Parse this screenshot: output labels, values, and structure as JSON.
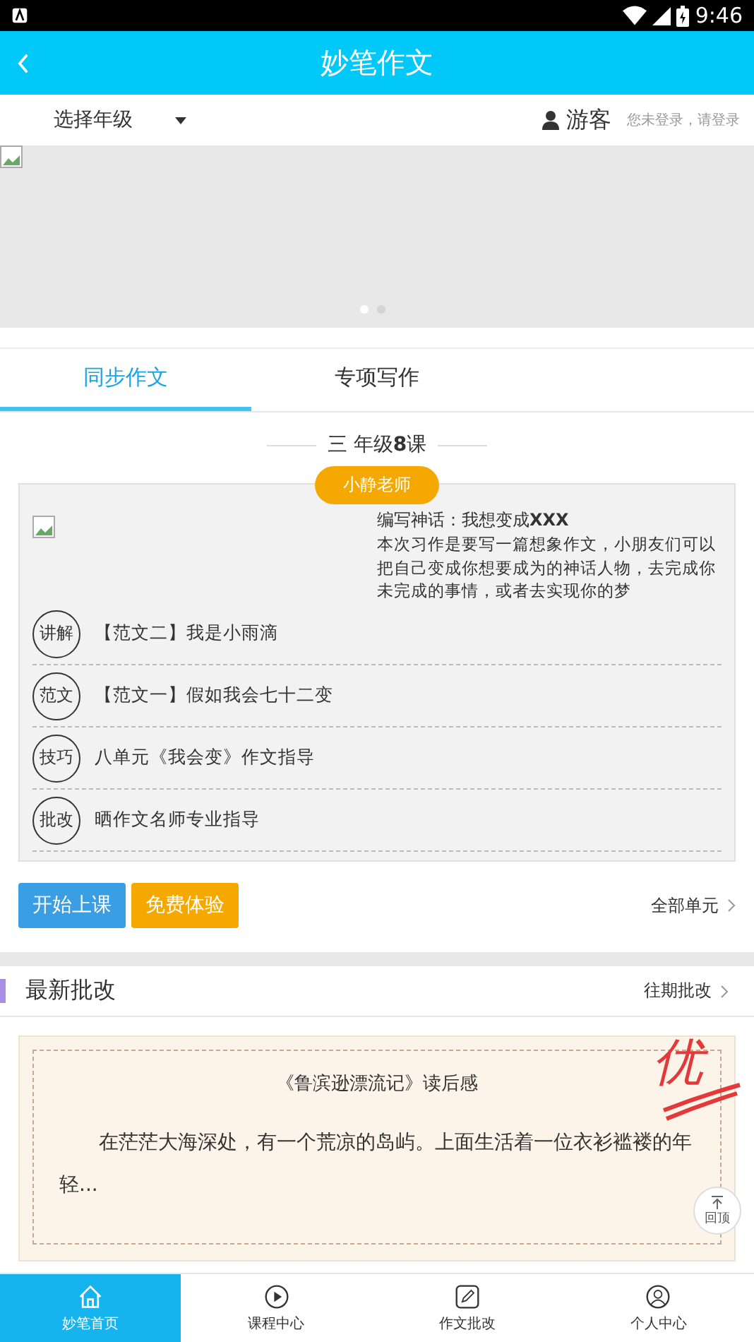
{
  "status_bar": {
    "time": "9:46"
  },
  "header": {
    "title": "妙笔作文"
  },
  "grade_bar": {
    "grade_select": "选择年级",
    "user_name": "游客",
    "login_hint": "您未登录，请登录"
  },
  "banner": {
    "dots": [
      {
        "selected": true
      },
      {
        "selected": false
      }
    ]
  },
  "tabs": [
    {
      "label": "同步作文",
      "selected": true
    },
    {
      "label": "专项写作",
      "selected": false
    }
  ],
  "lesson": {
    "heading": "三 年级**8**课",
    "teacher": "小静老师",
    "title": "编写神话：我想变成**XXX**",
    "description": "本次习作是要写一篇想象作文，小朋友们可以把自己变成你想要成为的神话人物，去完成你未完成的事情，或者去实现你的梦",
    "items": [
      {
        "tag": "讲解",
        "text": "【范文二】我是小雨滴"
      },
      {
        "tag": "范文",
        "text": "【范文一】假如我会七十二变"
      },
      {
        "tag": "技巧",
        "text": "八单元《我会变》作文指导"
      },
      {
        "tag": "批改",
        "text": "晒作文名师专业指导"
      }
    ],
    "buttons": [
      {
        "label": "开始上课",
        "kind": "primary"
      },
      {
        "label": "免费体验",
        "kind": "trial"
      }
    ],
    "all_units": "全部单元"
  },
  "latest": {
    "title": "最新批改",
    "more": "往期批改",
    "essay": {
      "title": "《鲁滨逊漂流记》读后感",
      "excerpt": "在茫茫大海深处，有一个荒凉的岛屿。上面生活着一位衣衫褴褛的年轻...",
      "grade_mark": "优"
    },
    "back_to_top": "回顶"
  },
  "bottom_nav": [
    {
      "label": "妙笔首页",
      "kind": "home",
      "selected": true
    },
    {
      "label": "课程中心",
      "kind": "courses",
      "selected": false
    },
    {
      "label": "作文批改",
      "kind": "review",
      "selected": false
    },
    {
      "label": "个人中心",
      "kind": "profile",
      "selected": false
    }
  ]
}
